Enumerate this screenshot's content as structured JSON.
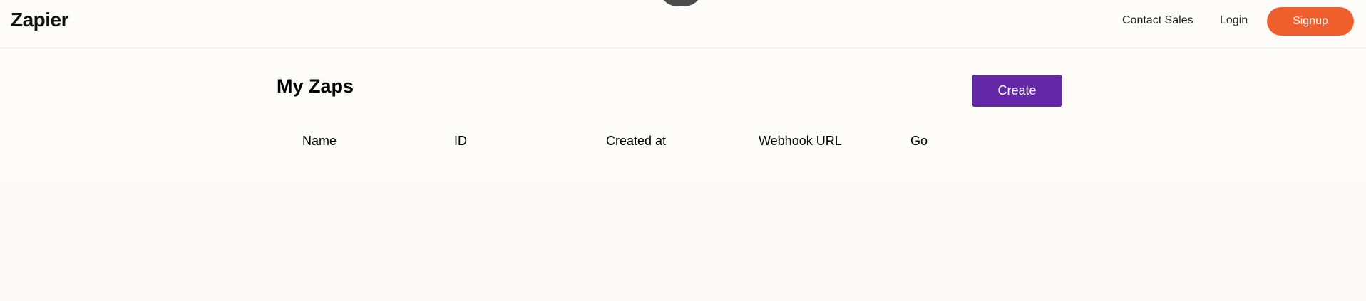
{
  "navbar": {
    "logo": "Zapier",
    "links": {
      "contact_sales": "Contact Sales",
      "login": "Login"
    },
    "signup_label": "Signup"
  },
  "main": {
    "title": "My Zaps",
    "create_label": "Create",
    "table": {
      "columns": [
        "Name",
        "ID",
        "Created at",
        "Webhook URL",
        "Go"
      ],
      "rows": []
    }
  },
  "colors": {
    "signup": "#ee5f2d",
    "create": "#6428a6",
    "background": "#fdfcf8"
  }
}
